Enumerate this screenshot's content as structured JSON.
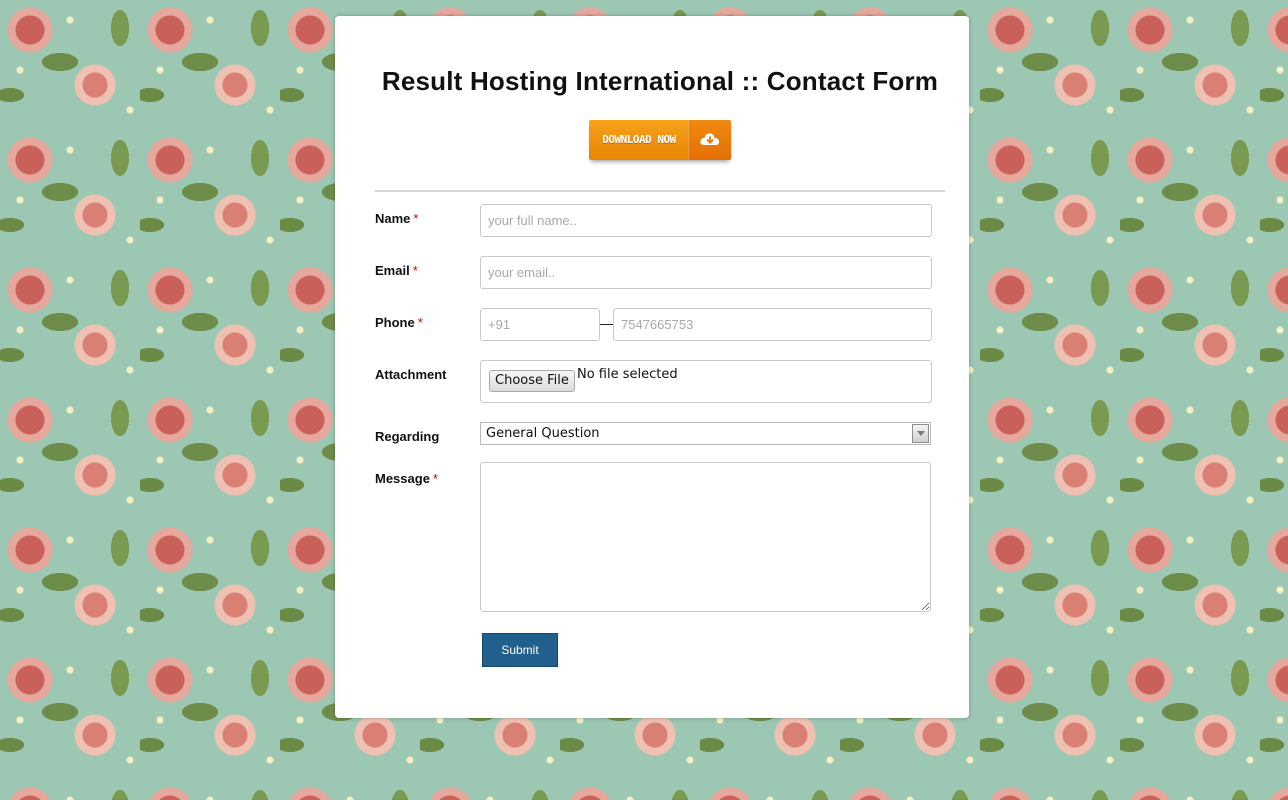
{
  "form": {
    "title": "Result Hosting International :: Contact Form",
    "download_label": "DOWNLOAD NOW",
    "download_icon": "cloud-download-icon",
    "fields": {
      "name": {
        "label": "Name",
        "required_mark": "*",
        "placeholder": "your full name.."
      },
      "email": {
        "label": "Email",
        "required_mark": "*",
        "placeholder": "your email.."
      },
      "phone": {
        "label": "Phone",
        "required_mark": "*",
        "code_placeholder": "+91",
        "number_placeholder": "7547665753"
      },
      "attachment": {
        "label": "Attachment",
        "button_label": "Choose File",
        "status": "No file selected"
      },
      "regarding": {
        "label": "Regarding",
        "selected": "General Question",
        "arrow_icon": "dropdown-arrow-icon"
      },
      "message": {
        "label": "Message",
        "required_mark": "*"
      }
    },
    "submit_label": "Submit"
  },
  "colors": {
    "accent_orange": "#f39314",
    "submit_blue": "#215f8c",
    "required_red": "#dd0000",
    "background_green": "#9cc7b3"
  }
}
